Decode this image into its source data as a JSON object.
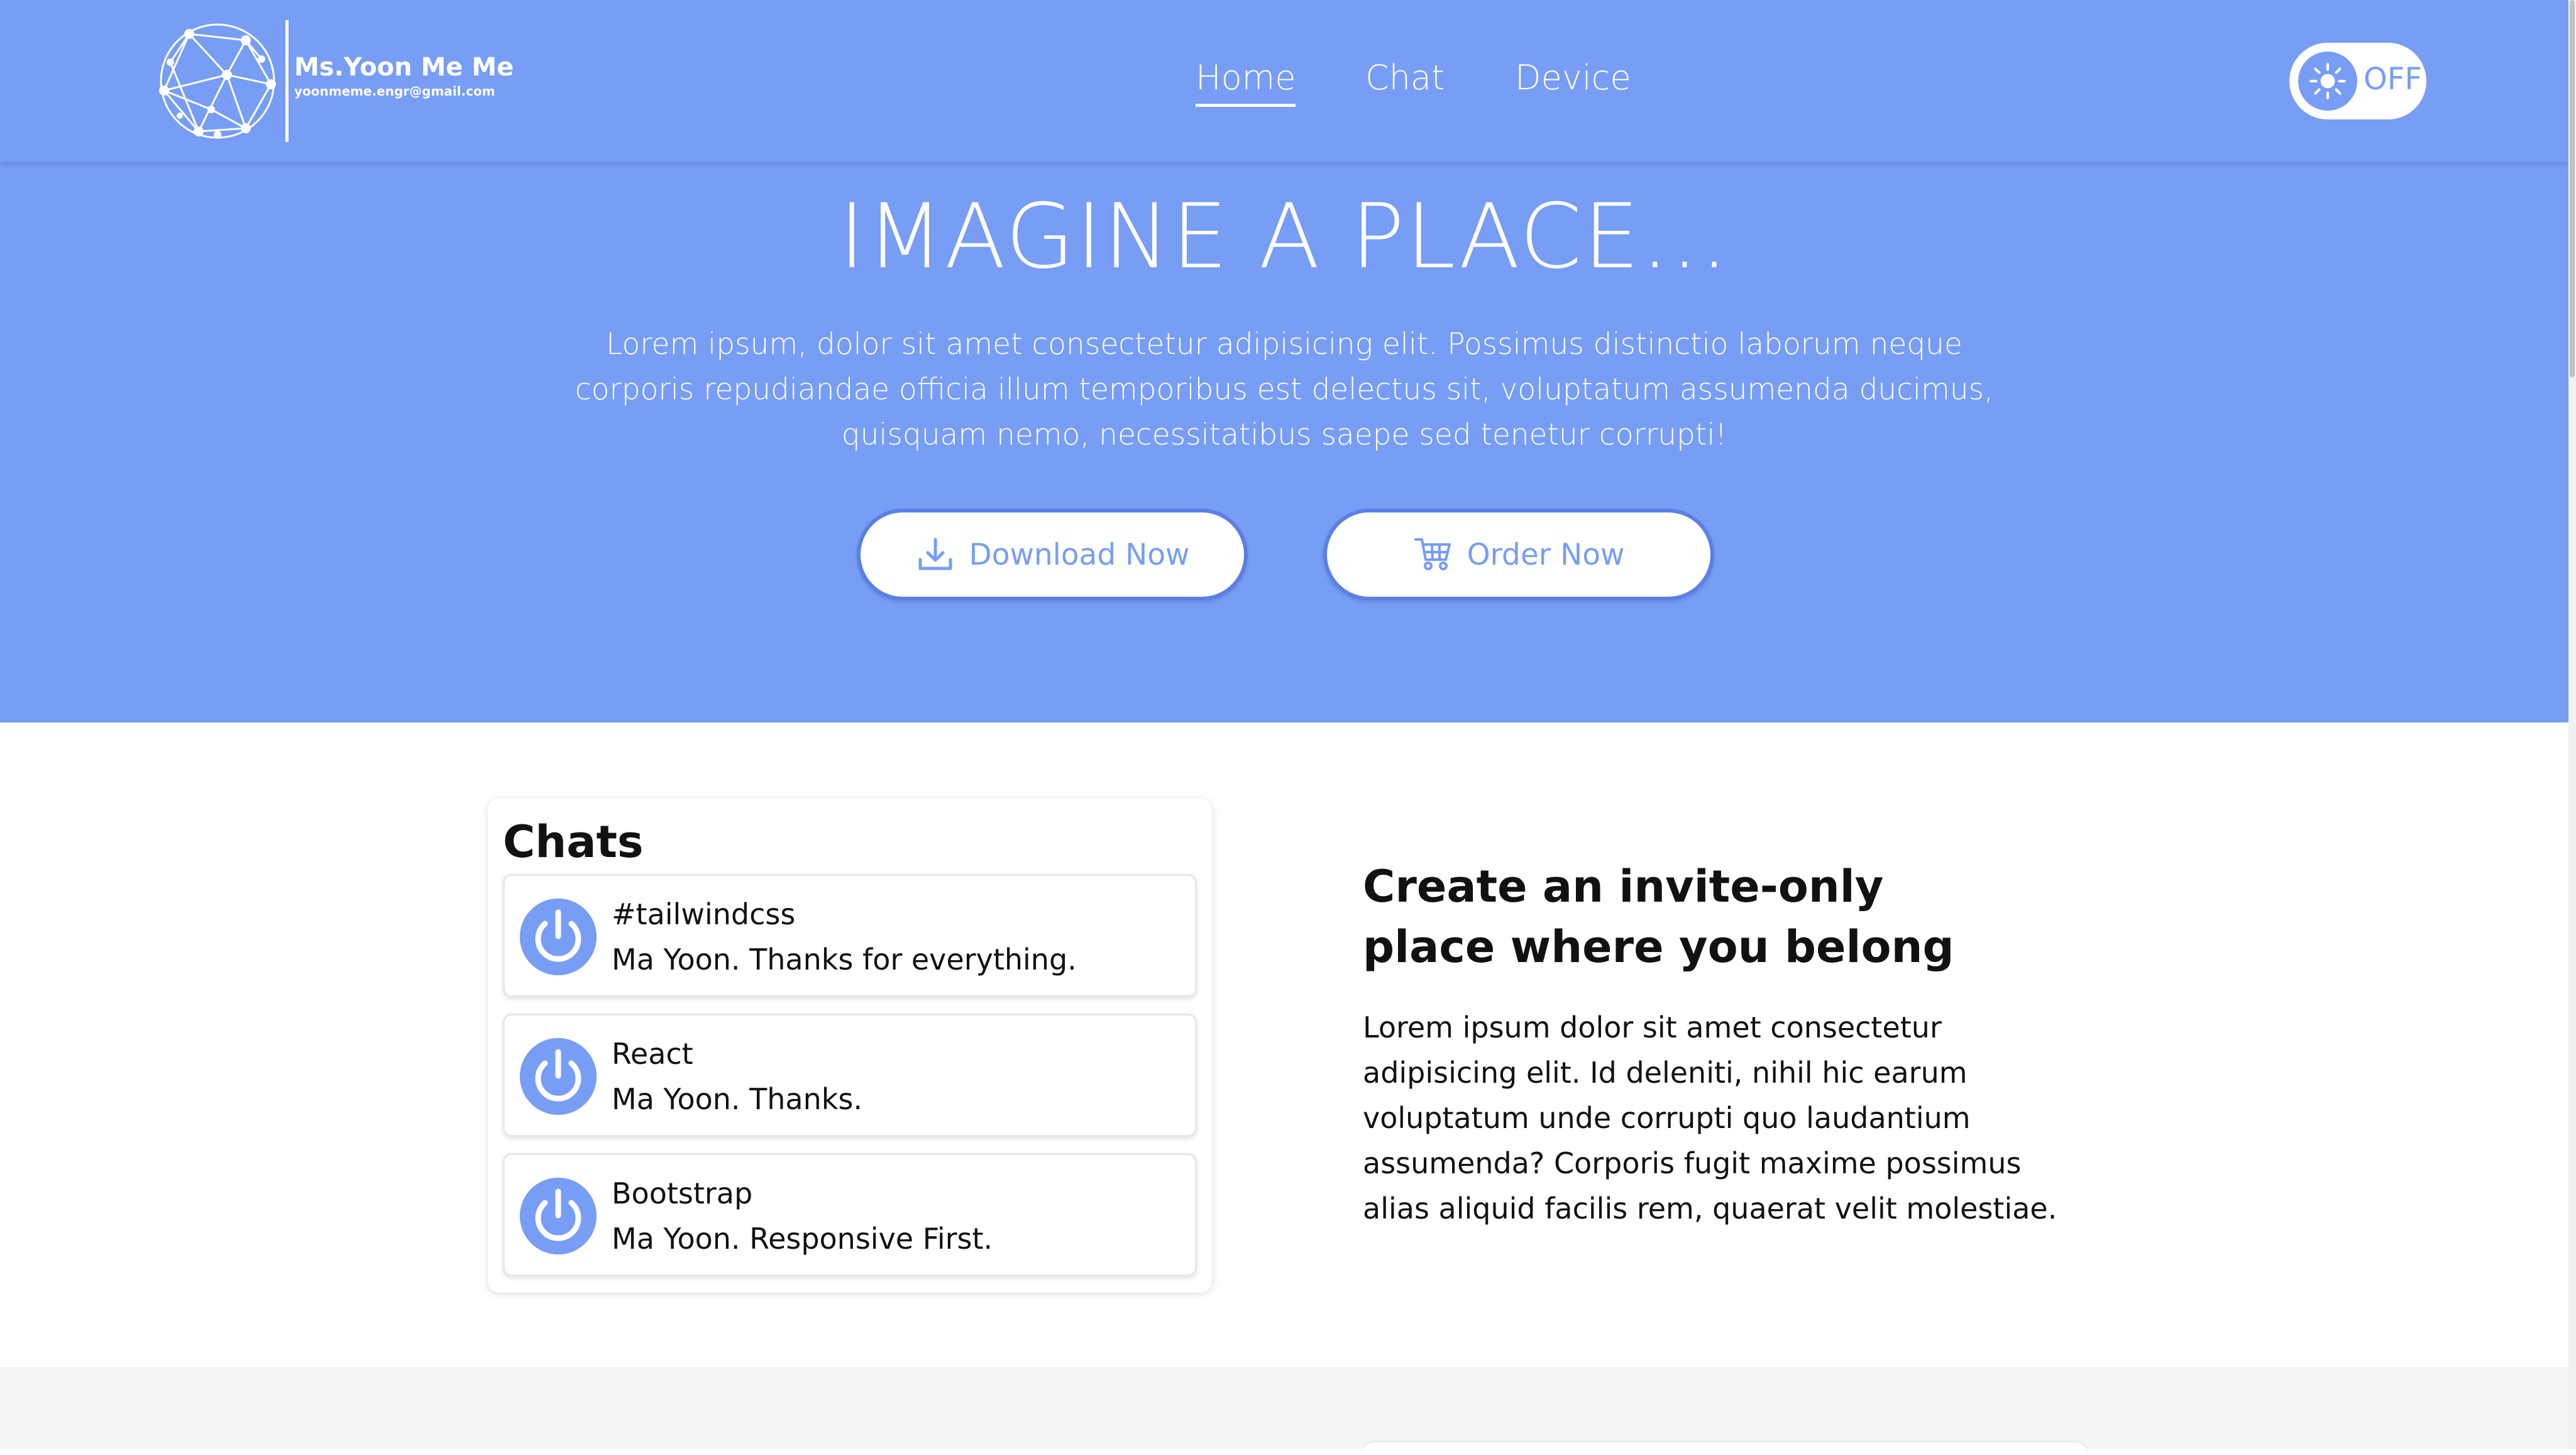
{
  "header": {
    "brand_name": "Ms.Yoon Me Me",
    "brand_email": "yoonmeme.engr@gmail.com",
    "nav": [
      "Home",
      "Chat",
      "Device"
    ],
    "active_nav": "Home",
    "toggle_label": "OFF",
    "toggle_icon": "sun-icon"
  },
  "hero": {
    "title": "IMAGINE A PLACE...",
    "text": "Lorem ipsum, dolor sit amet consectetur adipisicing elit. Possimus distinctio laborum neque corporis repudiandae officia illum temporibus est delectus sit, voluptatum assumenda ducimus, quisquam nemo, necessitatibus saepe sed tenetur corrupti!",
    "download_label": "Download Now",
    "download_icon": "download-icon",
    "order_label": "Order Now",
    "order_icon": "cart-icon"
  },
  "chats": {
    "title": "Chats",
    "items": [
      {
        "name": "#tailwindcss",
        "message": "Ma Yoon. Thanks for everything.",
        "icon": "power-icon"
      },
      {
        "name": "React",
        "message": "Ma Yoon. Thanks.",
        "icon": "power-icon"
      },
      {
        "name": "Bootstrap",
        "message": "Ma Yoon. Responsive First.",
        "icon": "power-icon"
      }
    ]
  },
  "invite": {
    "title": "Create an invite-only place where you belong",
    "text": "Lorem ipsum dolor sit amet consectetur adipisicing elit. Id deleniti, nihil hic earum voluptatum unde corrupti quo laudantium assumenda? Corporis fugit maxime possimus alias aliquid facilis rem, quaerat velit molestiae."
  },
  "colors": {
    "accent": "#779df5",
    "white": "#ffffff",
    "text": "#111111",
    "section_gray": "#f3f4f6"
  }
}
